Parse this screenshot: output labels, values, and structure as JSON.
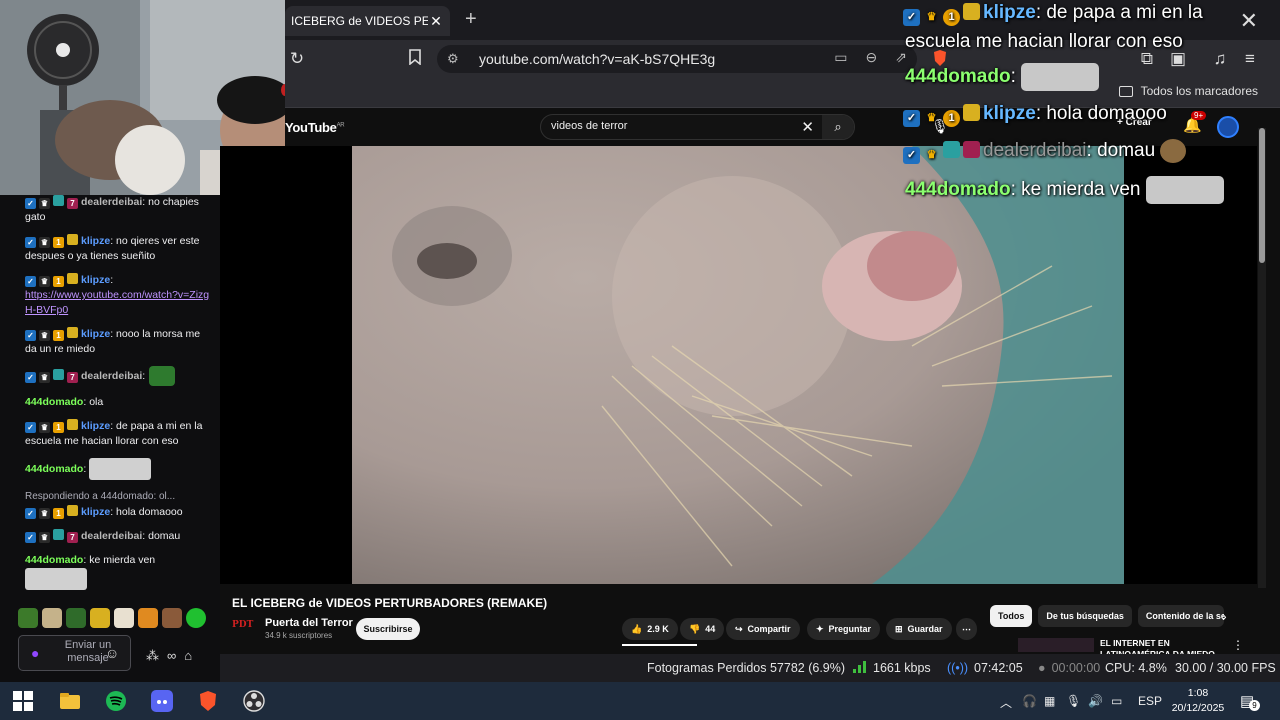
{
  "browser": {
    "tab_title": "ICEBERG de VIDEOS PERTURBADORES",
    "url": "youtube.com/watch?v=aK-bS7QHE3g",
    "bookmarks_all": "Todos los marcadores"
  },
  "youtube": {
    "logo": "YouTube",
    "logo_region": "AR",
    "search_value": "videos de terror",
    "create_label": "+ Crear",
    "notifications_count": "9+",
    "video_title": "EL ICEBERG de VIDEOS PERTURBADORES (REMAKE)",
    "channel_logo": "PDT",
    "channel_name": "Puerta del Terror",
    "channel_subs": "34.9 k suscriptores",
    "subscribe_label": "Suscribirse",
    "likes": "2.9 K",
    "dislikes": "44",
    "share_label": "Compartir",
    "ask_label": "Preguntar",
    "save_label": "Guardar",
    "chips": [
      "Todos",
      "De tus búsquedas",
      "Contenido de la se"
    ],
    "rec_title_line1": "EL INTERNET EN",
    "rec_title_line2": "LATINOAMÉRICA DA MIEDO"
  },
  "chat": {
    "messages": [
      {
        "user": "dealerdeibai",
        "sep": ": ",
        "text": "no chapies gato",
        "color": "#b8b8b8"
      },
      {
        "user": "klipze",
        "sep": ": ",
        "text": "no qieres ver este despues o ya tienes sueñito",
        "color": "#5c9dff"
      },
      {
        "user": "klipze",
        "sep": ": ",
        "text": "",
        "link": "https://www.youtube.com/watch?v=ZizgH-BVFp0",
        "color": "#5c9dff"
      },
      {
        "user": "klipze",
        "sep": ": ",
        "text": "nooo la morsa me da un re miedo",
        "color": "#5c9dff"
      },
      {
        "user": "dealerdeibai",
        "sep": ":",
        "text": "",
        "color": "#b8b8b8"
      },
      {
        "user": "444domado",
        "sep": ": ",
        "text": "ola",
        "color": "#7cff5a"
      },
      {
        "user": "klipze",
        "sep": ": ",
        "text": "de papa a mi en la escuela me hacian llorar con eso",
        "color": "#5c9dff"
      },
      {
        "user": "444domado",
        "sep": ":",
        "text": "",
        "color": "#7cff5a"
      },
      {
        "user": "klipze",
        "sep": ": ",
        "text": "hola domaooo",
        "color": "#5c9dff",
        "reply": "Respondiendo a 444domado: ol..."
      },
      {
        "user": "dealerdeibai",
        "sep": ": ",
        "text": "domau",
        "color": "#b8b8b8"
      },
      {
        "user": "444domado",
        "sep": ": ",
        "text": "ke mierda ven",
        "color": "#7cff5a"
      }
    ],
    "input_placeholder": "Enviar un mensaje"
  },
  "overlay": {
    "line1_user": "klipze",
    "line1_text": ": de papa a mi en la",
    "line2_text": "escuela me hacian llorar con eso",
    "line3_user": "444domado",
    "line3_text": ":",
    "line4_user": "klipze",
    "line4_text": ": hola domaooo",
    "line5_user": "dealerdeibai",
    "line5_text": ": domau",
    "line6_user": "444domado",
    "line6_text": ": ke mierda ven"
  },
  "obs": {
    "dropped": "Fotogramas Perdidos 57782 (6.9%)",
    "bitrate": "1661 kbps",
    "live_time": "07:42:05",
    "rec_time": "00:00:00",
    "cpu": "CPU: 4.8%",
    "fps": "30.00 / 30.00 FPS"
  },
  "taskbar": {
    "lang": "ESP",
    "time": "1:08",
    "date": "20/12/2025",
    "notif_count": "9"
  },
  "colors": {
    "accent_purple": "#9147ff",
    "brave_orange": "#fb542b",
    "twitch_blue_user": "#5c9dff",
    "green_user": "#7cff5a"
  }
}
